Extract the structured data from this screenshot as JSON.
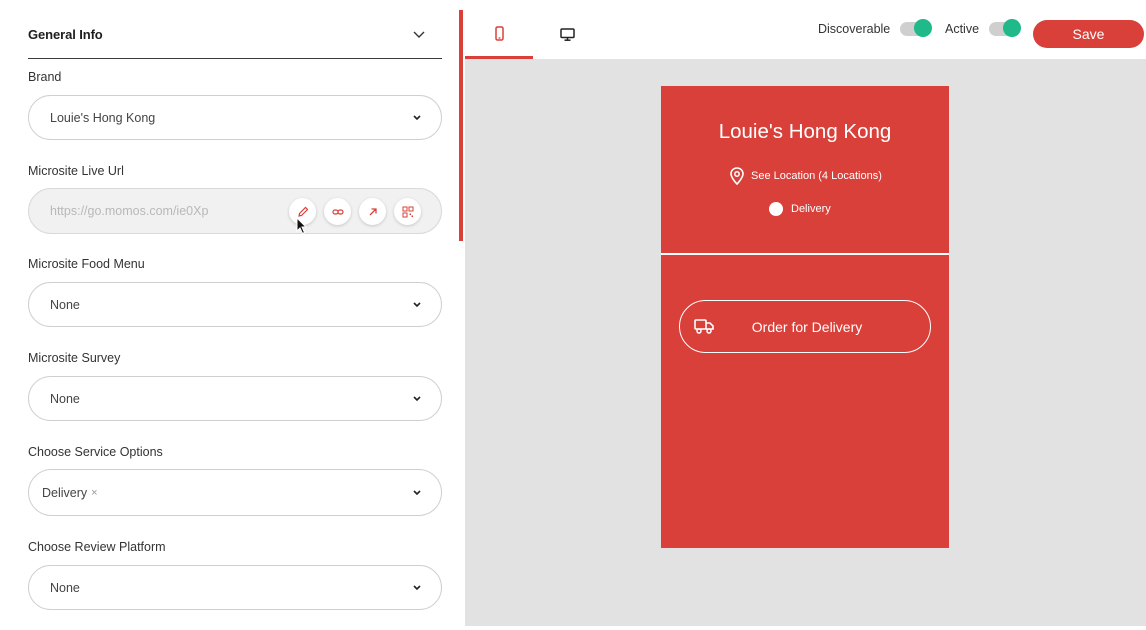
{
  "form": {
    "section_title": "General Info",
    "brand": {
      "label": "Brand",
      "value": "Louie's Hong Kong"
    },
    "microsite_url": {
      "label": "Microsite Live Url",
      "value": "https://go.momos.com/ie0Xp"
    },
    "food_menu": {
      "label": "Microsite Food Menu",
      "value": "None"
    },
    "survey": {
      "label": "Microsite Survey",
      "value": "None"
    },
    "service_options": {
      "label": "Choose Service Options",
      "chip": "Delivery",
      "chip_remove": "×"
    },
    "review_platform": {
      "label": "Choose Review Platform",
      "value": "None"
    }
  },
  "topbar": {
    "tabs": [
      "mobile-view",
      "desktop-view"
    ],
    "discoverable_label": "Discoverable",
    "discoverable_on": true,
    "active_label": "Active",
    "active_on": true,
    "save_label": "Save"
  },
  "preview": {
    "title": "Louie's Hong Kong",
    "location_text": "See Location (4 Locations)",
    "delivery_text": "Delivery",
    "order_label": "Order for Delivery"
  },
  "colors": {
    "accent": "#d9403a",
    "toggle_on": "#1fb98a",
    "preview_bg": "#e2e2e2"
  }
}
